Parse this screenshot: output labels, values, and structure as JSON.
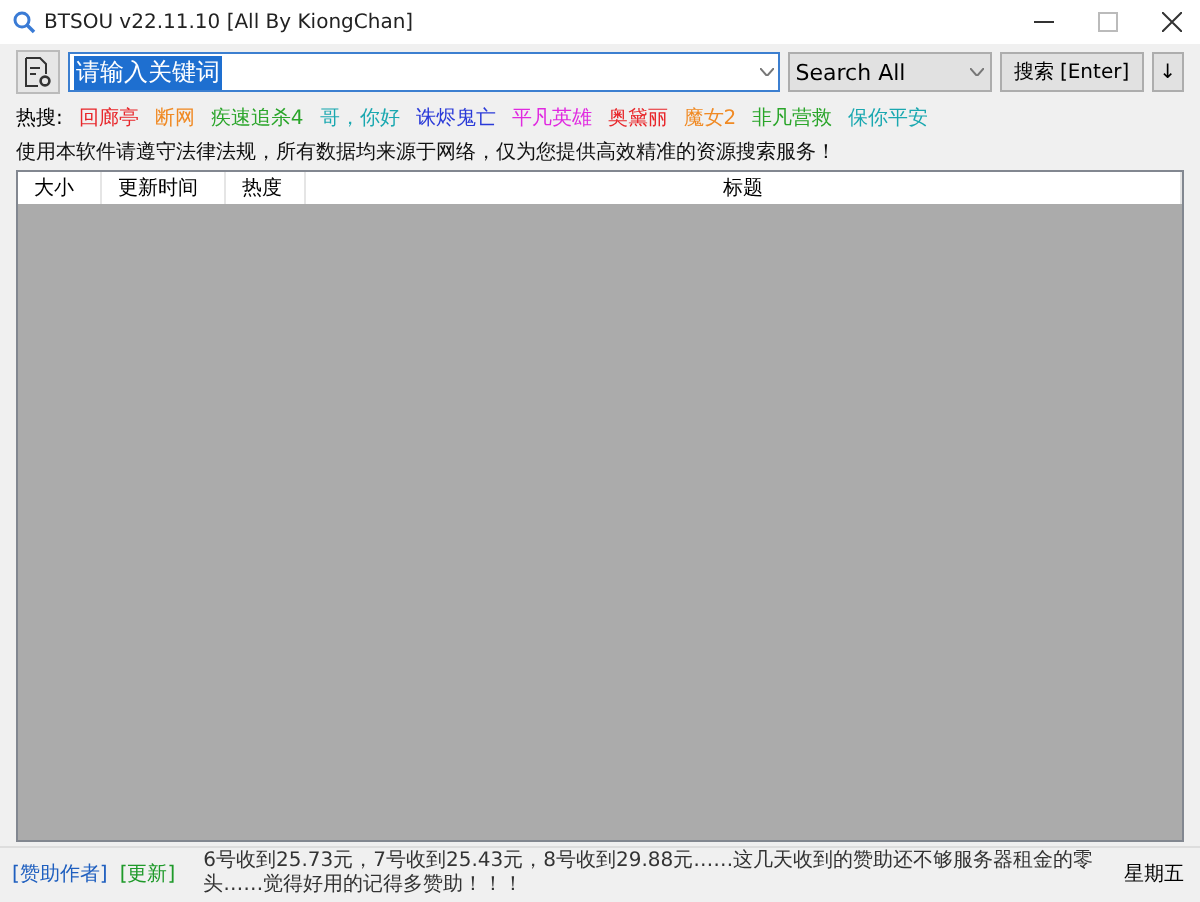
{
  "window": {
    "title": "BTSOU v22.11.10 [All By KiongChan]"
  },
  "search": {
    "value": "请输入关键词",
    "scope": "Search All",
    "button": "搜索 [Enter]",
    "sort_button": "↓"
  },
  "hot": {
    "label": "热搜:",
    "items": [
      {
        "text": "回廊亭",
        "color": "#e8262a"
      },
      {
        "text": "断网",
        "color": "#f08a24"
      },
      {
        "text": "疾速追杀4",
        "color": "#2aa52a"
      },
      {
        "text": "哥，你好",
        "color": "#1aa8b0"
      },
      {
        "text": "诛烬鬼亡",
        "color": "#2a3ad8"
      },
      {
        "text": "平凡英雄",
        "color": "#e02ae0"
      },
      {
        "text": "奥黛丽",
        "color": "#e8262a"
      },
      {
        "text": "魔女2",
        "color": "#f08a24"
      },
      {
        "text": "非凡营救",
        "color": "#2aa52a"
      },
      {
        "text": "保你平安",
        "color": "#1aa8b0"
      }
    ]
  },
  "notice": "使用本软件请遵守法律法规，所有数据均来源于网络，仅为您提供高效精准的资源搜索服务！",
  "table": {
    "columns": [
      "大小",
      "更新时间",
      "热度",
      "标题"
    ]
  },
  "status_bar": {
    "links": [
      {
        "text": "[赞助作者]",
        "color": "#1f5fbf"
      },
      {
        "text": "[更新]",
        "color": "#1f9a2a"
      }
    ],
    "message": "6号收到25.73元，7号收到25.43元，8号收到29.88元……这几天收到的赞助还不够服务器租金的零头……觉得好用的记得多赞助！！！",
    "day": "星期五"
  }
}
